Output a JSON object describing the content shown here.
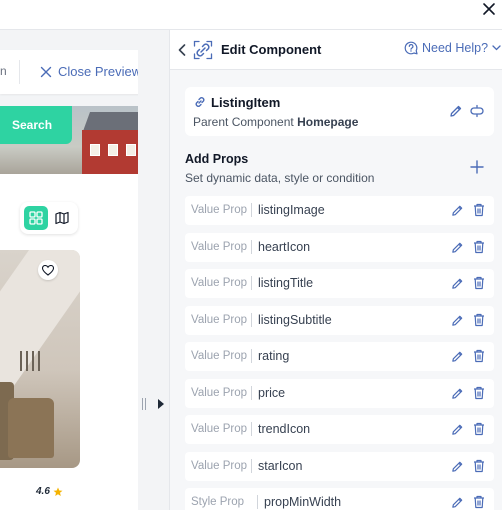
{
  "window": {
    "close_icon": "close-icon"
  },
  "preview": {
    "toolbar_cut_text": "n",
    "close_preview_label": "Close Preview",
    "search_label": "Search",
    "rating": "4.6"
  },
  "panel": {
    "title": "Edit Component",
    "help_label": "Need Help?",
    "component": {
      "name": "ListingItem",
      "parent_prefix": "Parent Component",
      "parent_name": "Homepage"
    },
    "add_props": {
      "title": "Add Props",
      "subtitle": "Set dynamic data, style or condition"
    },
    "props": [
      {
        "type": "Value Prop",
        "name": "listingImage"
      },
      {
        "type": "Value Prop",
        "name": "heartIcon"
      },
      {
        "type": "Value Prop",
        "name": "listingTitle"
      },
      {
        "type": "Value Prop",
        "name": "listingSubtitle"
      },
      {
        "type": "Value Prop",
        "name": "rating"
      },
      {
        "type": "Value Prop",
        "name": "price"
      },
      {
        "type": "Value Prop",
        "name": "trendIcon"
      },
      {
        "type": "Value Prop",
        "name": "starIcon"
      },
      {
        "type": "Style Prop",
        "name": "propMinWidth"
      }
    ]
  },
  "colors": {
    "accent_green": "#2ed3a2",
    "link_blue": "#4b6cb7",
    "icon_blue": "#4b6cb7"
  }
}
